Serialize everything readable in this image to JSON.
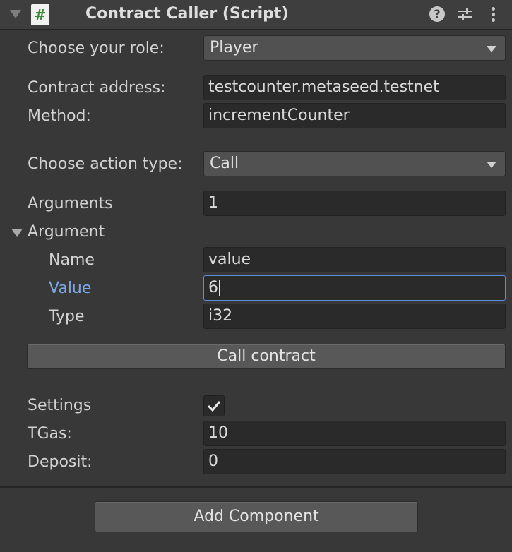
{
  "component": {
    "title": "Contract Caller (Script)",
    "script_icon_glyph": "#"
  },
  "fields": {
    "role_label": "Choose your role:",
    "role_value": "Player",
    "contract_address_label": "Contract address:",
    "contract_address_value": "testcounter.metaseed.testnet",
    "method_label": "Method:",
    "method_value": "incrementCounter",
    "action_type_label": "Choose action type:",
    "action_type_value": "Call",
    "arguments_label": "Arguments",
    "arguments_value": "1",
    "argument_foldout_label": "Argument",
    "arg_name_label": "Name",
    "arg_name_value": "value",
    "arg_value_label": "Value",
    "arg_value_value": "6",
    "arg_type_label": "Type",
    "arg_type_value": "i32",
    "call_button_label": "Call contract",
    "settings_label": "Settings",
    "settings_checked": true,
    "tgas_label": "TGas:",
    "tgas_value": "10",
    "deposit_label": "Deposit:",
    "deposit_value": "0"
  },
  "footer": {
    "add_component_label": "Add Component"
  },
  "icons": {
    "help": "help-icon",
    "presets": "presets-icon",
    "menu": "menu-icon",
    "dropdown": "chevron-down-icon",
    "foldout": "triangle-down-icon",
    "checkmark": "checkmark-icon"
  },
  "colors": {
    "panel_bg": "#383838",
    "field_bg": "#2a2a2a",
    "focus_border": "#5b8fd6",
    "active_label": "#7ba7e6",
    "script_icon_green": "#3a8b3a"
  }
}
